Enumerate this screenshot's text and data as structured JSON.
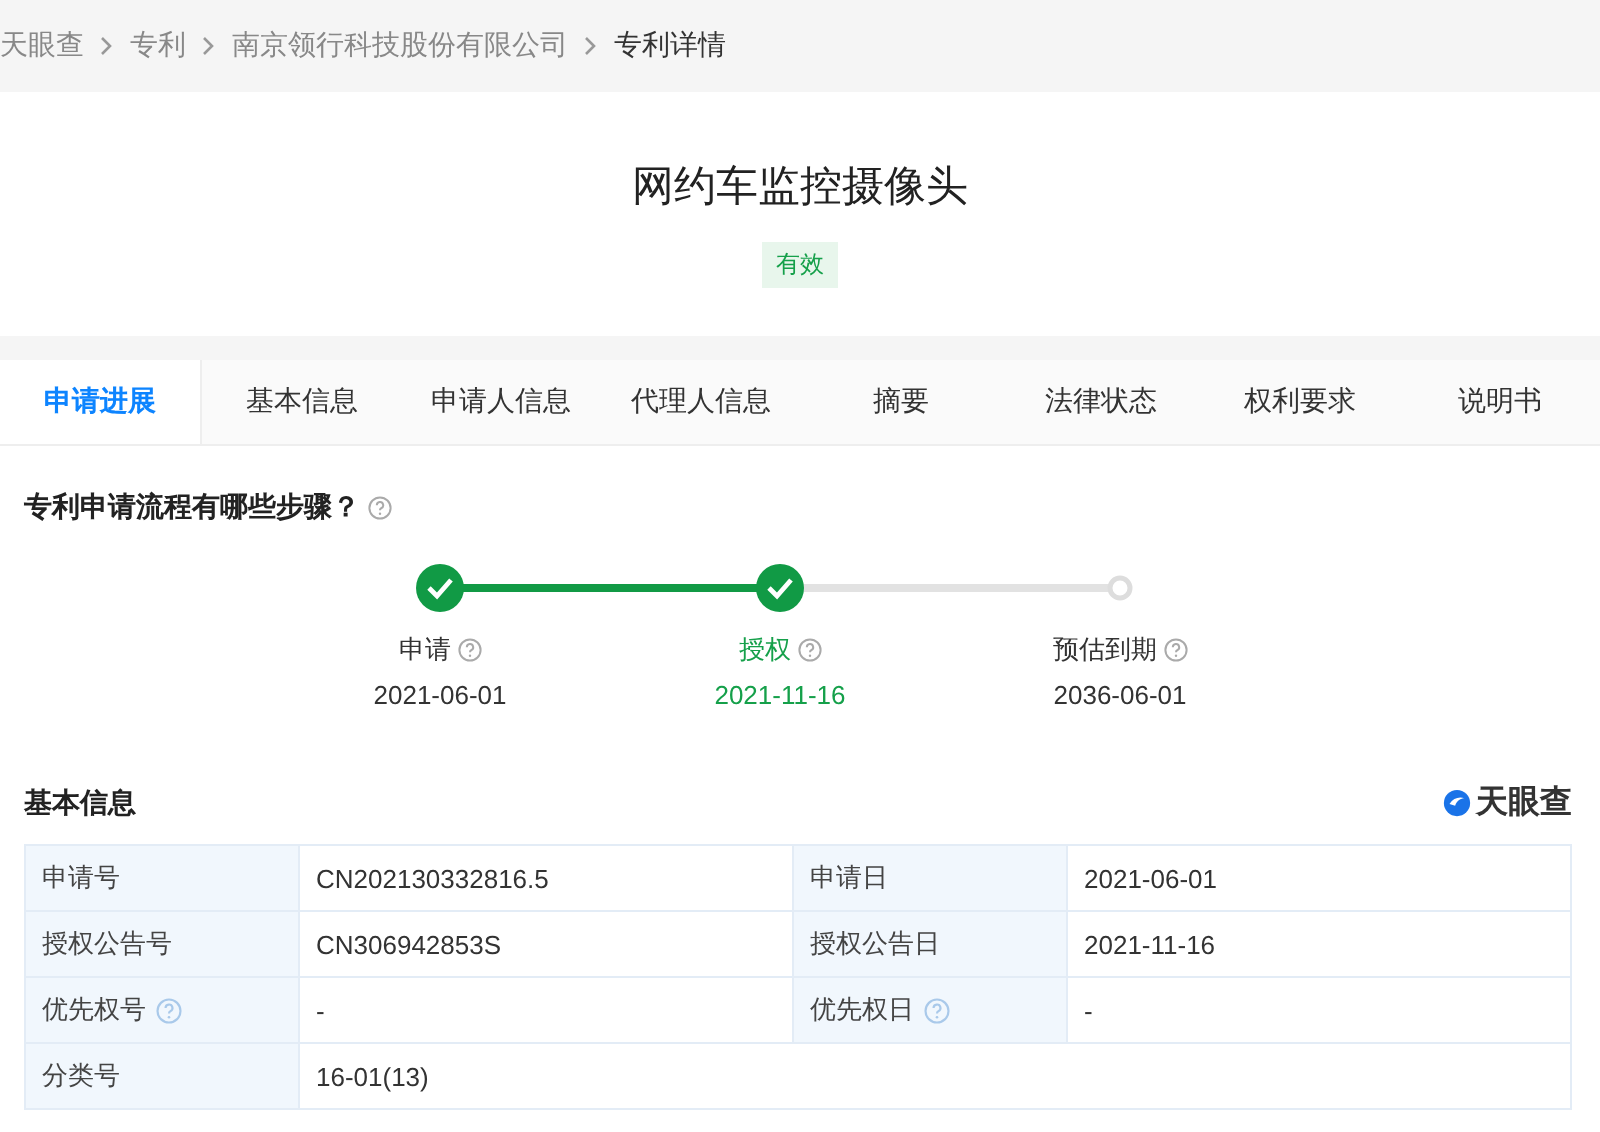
{
  "breadcrumb": [
    "天眼查",
    "专利",
    "南京领行科技股份有限公司",
    "专利详情"
  ],
  "title": "网约车监控摄像头",
  "status_tag": "有效",
  "tabs": [
    {
      "label": "申请进展",
      "selected": true
    },
    {
      "label": "基本信息",
      "selected": false
    },
    {
      "label": "申请人信息",
      "selected": false
    },
    {
      "label": "代理人信息",
      "selected": false
    },
    {
      "label": "摘要",
      "selected": false
    },
    {
      "label": "法律状态",
      "selected": false
    },
    {
      "label": "权利要求",
      "selected": false
    },
    {
      "label": "说明书",
      "selected": false
    }
  ],
  "process": {
    "heading": "专利申请流程有哪些步骤？",
    "steps": [
      {
        "label": "申请",
        "date": "2021-06-01",
        "done": true,
        "selected": false
      },
      {
        "label": "授权",
        "date": "2021-11-16",
        "done": true,
        "selected": true
      },
      {
        "label": "预估到期",
        "date": "2036-06-01",
        "done": false,
        "selected": false
      }
    ]
  },
  "basic_info": {
    "heading": "基本信息",
    "brand": "天眼查",
    "rows": [
      [
        {
          "label": "申请号",
          "help": false,
          "value": "CN202130332816.5"
        },
        {
          "label": "申请日",
          "help": false,
          "value": "2021-06-01"
        }
      ],
      [
        {
          "label": "授权公告号",
          "help": false,
          "value": "CN306942853S"
        },
        {
          "label": "授权公告日",
          "help": false,
          "value": "2021-11-16"
        }
      ],
      [
        {
          "label": "优先权号",
          "help": true,
          "value": "-"
        },
        {
          "label": "优先权日",
          "help": true,
          "value": "-"
        }
      ],
      [
        {
          "label": "分类号",
          "help": false,
          "value": "16-01(13)"
        }
      ]
    ]
  }
}
